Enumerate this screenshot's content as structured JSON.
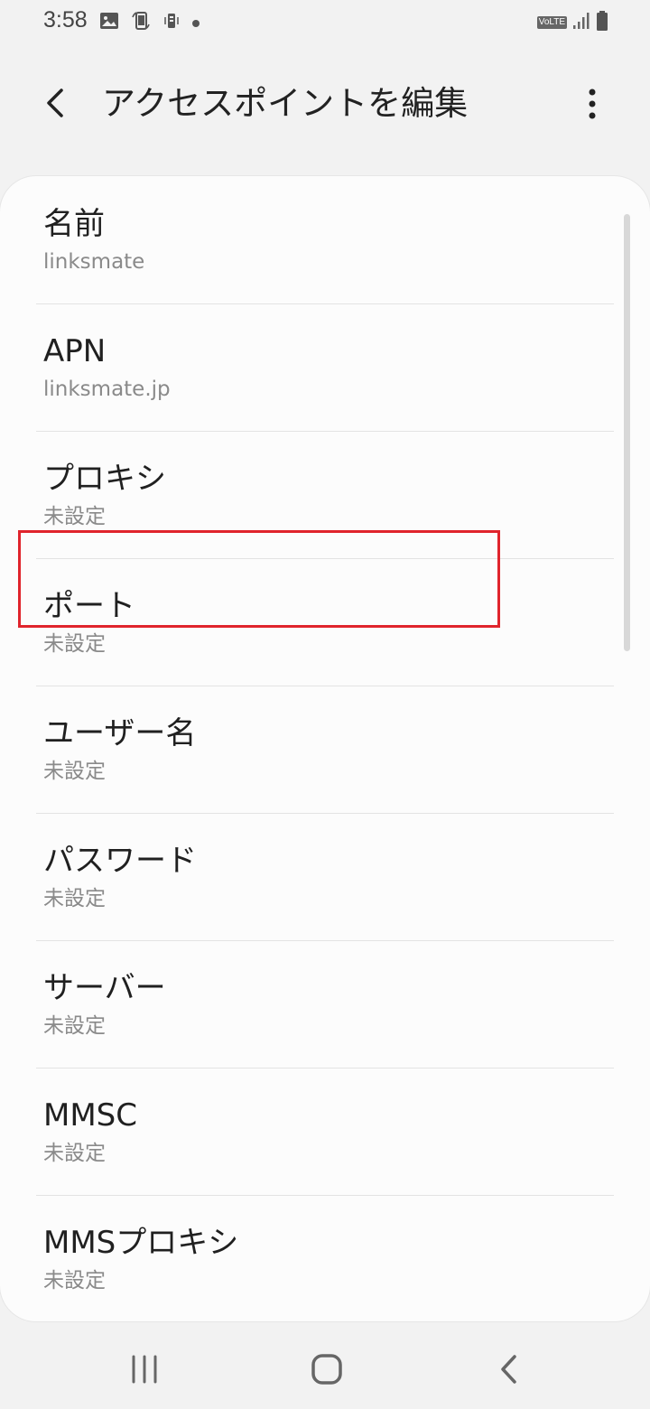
{
  "status_bar": {
    "time": "3:58",
    "left_icons": [
      "image-icon",
      "rotate-phone-icon",
      "phone-vibrate-icon",
      "dot-icon"
    ],
    "volte_label": "VoLTE",
    "right_icons": [
      "signal-icon",
      "battery-icon"
    ]
  },
  "app_bar": {
    "title": "アクセスポイントを編集",
    "back_icon": "chevron-left-icon",
    "more_icon": "more-vert-icon"
  },
  "settings": {
    "items": [
      {
        "title": "名前",
        "value": "linksmate"
      },
      {
        "title": "APN",
        "value": "linksmate.jp"
      },
      {
        "title": "プロキシ",
        "value": "未設定"
      },
      {
        "title": "ポート",
        "value": "未設定"
      },
      {
        "title": "ユーザー名",
        "value": "未設定"
      },
      {
        "title": "パスワード",
        "value": "未設定"
      },
      {
        "title": "サーバー",
        "value": "未設定"
      },
      {
        "title": "MMSC",
        "value": "未設定"
      },
      {
        "title": "MMSプロキシ",
        "value": "未設定"
      }
    ],
    "highlighted_index": 4,
    "highlight_color": "#e0242c"
  },
  "nav_bar": {
    "icons": [
      "recent-apps-icon",
      "home-icon",
      "back-icon"
    ]
  }
}
